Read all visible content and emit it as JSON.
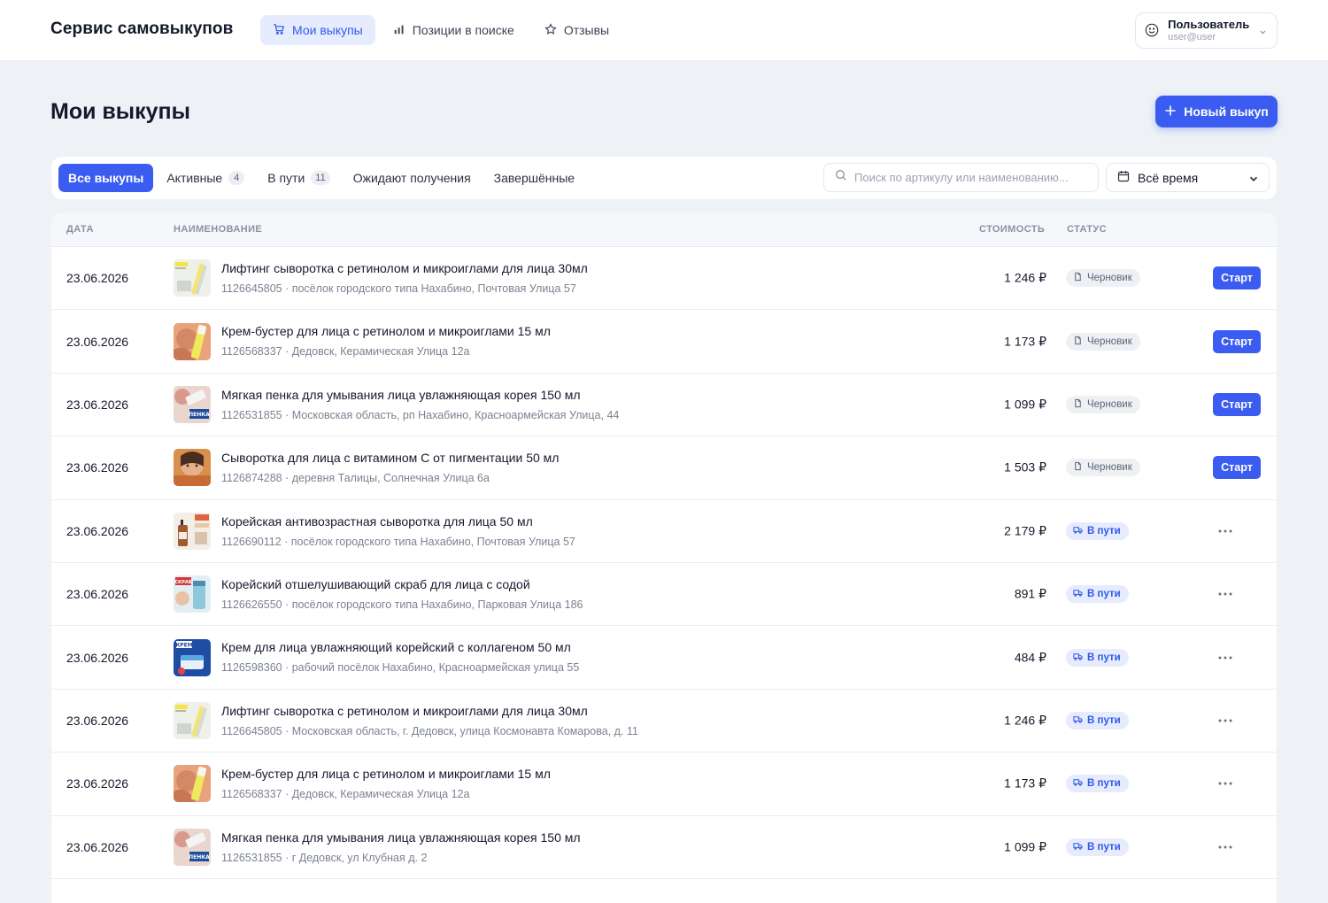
{
  "app": {
    "title": "Сервис самовыкупов"
  },
  "nav": [
    {
      "label": "Мои выкупы",
      "icon": "cart-icon",
      "active": true
    },
    {
      "label": "Позиции в поиске",
      "icon": "bar-chart-icon",
      "active": false
    },
    {
      "label": "Отзывы",
      "icon": "star-icon",
      "active": false
    }
  ],
  "user": {
    "name": "Пользователь",
    "email": "user@user"
  },
  "page": {
    "title": "Мои выкупы",
    "new_button": "Новый выкуп"
  },
  "tabs": [
    {
      "label": "Все выкупы",
      "count": "",
      "active": true
    },
    {
      "label": "Активные",
      "count": "4",
      "active": false
    },
    {
      "label": "В пути",
      "count": "11",
      "active": false
    },
    {
      "label": "Ожидают получения",
      "count": "",
      "active": false
    },
    {
      "label": "Завершённые",
      "count": "",
      "active": false
    }
  ],
  "search": {
    "placeholder": "Поиск по артикулу или наименованию..."
  },
  "period": {
    "value": "Всё время"
  },
  "table": {
    "columns": {
      "date": "ДАТА",
      "name": "НАИМЕНОВАНИЕ",
      "cost": "СТОИМОСТЬ",
      "status": "СТАТУС"
    },
    "start_label": "Старт",
    "rows": [
      {
        "date": "23.06.2026",
        "name": "Лифтинг сыворотка с ретинолом и микроиглами для лица 30мл",
        "sub": "1126645805 · посёлок городского типа Нахабино, Почтовая Улица 57",
        "price": "1 246 ₽",
        "status": "Черновик",
        "kind": "draft",
        "thumb": "lift"
      },
      {
        "date": "23.06.2026",
        "name": "Крем-бустер для лица с ретинолом и микроиглами 15 мл",
        "sub": "1126568337 · Дедовск, Керамическая Улица 12а",
        "price": "1 173 ₽",
        "status": "Черновик",
        "kind": "draft",
        "thumb": "booster"
      },
      {
        "date": "23.06.2026",
        "name": "Мягкая пенка для умывания лица увлажняющая корея 150 мл",
        "sub": "1126531855 · Московская область, рп Нахабино, Красноармейская Улица, 44",
        "price": "1 099 ₽",
        "status": "Черновик",
        "kind": "draft",
        "thumb": "foam"
      },
      {
        "date": "23.06.2026",
        "name": "Сыворотка для лица с витамином С от пигментации 50 мл",
        "sub": "1126874288 · деревня Талицы, Солнечная Улица 6а",
        "price": "1 503 ₽",
        "status": "Черновик",
        "kind": "draft",
        "thumb": "vitc"
      },
      {
        "date": "23.06.2026",
        "name": "Корейская антивозрастная сыворотка для лица 50 мл",
        "sub": "1126690112 · посёлок городского типа Нахабино, Почтовая Улица 57",
        "price": "2 179 ₽",
        "status": "В пути",
        "kind": "transit",
        "thumb": "serum"
      },
      {
        "date": "23.06.2026",
        "name": "Корейский отшелушивающий скраб для лица с содой",
        "sub": "1126626550 · посёлок городского типа Нахабино, Парковая Улица 186",
        "price": "891 ₽",
        "status": "В пути",
        "kind": "transit",
        "thumb": "scrub"
      },
      {
        "date": "23.06.2026",
        "name": "Крем для лица увлажняющий корейский с коллагеном 50 мл",
        "sub": "1126598360 · рабочий посёлок Нахабино, Красноармейская улица 55",
        "price": "484 ₽",
        "status": "В пути",
        "kind": "transit",
        "thumb": "cream"
      },
      {
        "date": "23.06.2026",
        "name": "Лифтинг сыворотка с ретинолом и микроиглами для лица 30мл",
        "sub": "1126645805 · Московская область, г. Дедовск, улица Космонавта Комарова, д. 11",
        "price": "1 246 ₽",
        "status": "В пути",
        "kind": "transit",
        "thumb": "lift"
      },
      {
        "date": "23.06.2026",
        "name": "Крем-бустер для лица с ретинолом и микроиглами 15 мл",
        "sub": "1126568337 · Дедовск, Керамическая Улица 12а",
        "price": "1 173 ₽",
        "status": "В пути",
        "kind": "transit",
        "thumb": "booster"
      },
      {
        "date": "23.06.2026",
        "name": "Мягкая пенка для умывания лица увлажняющая корея 150 мл",
        "sub": "1126531855 · г Дедовск, ул Клубная д. 2",
        "price": "1 099 ₽",
        "status": "В пути",
        "kind": "transit",
        "thumb": "foam"
      }
    ]
  },
  "thumb_texts": {
    "foam": "ПЕНКА",
    "scrub": "СКРАБ",
    "cream": "КРЕМ"
  },
  "colors": {
    "accent": "#3a5cf0",
    "accent_soft": "#e6ecfd",
    "background": "#eef1f6",
    "text": "#141a2b",
    "muted": "#7b8292"
  }
}
